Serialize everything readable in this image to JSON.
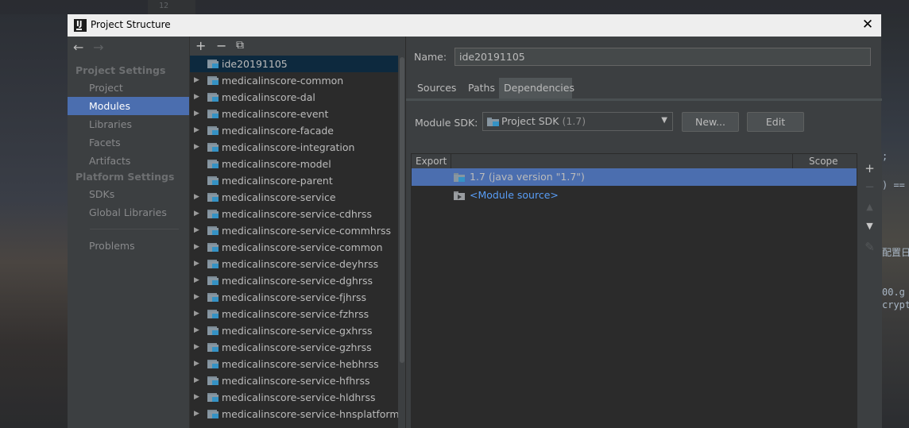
{
  "background": {
    "line_number": "12",
    "code_lines": [
      ";",
      ") ==",
      "配置日",
      "00.g",
      "crypt"
    ]
  },
  "dialog": {
    "title": "Project Structure",
    "close_glyph": "✕"
  },
  "left_nav": {
    "back_glyph": "←",
    "forward_glyph": "→",
    "project_settings_header": "Project Settings",
    "project_settings": [
      "Project",
      "Modules",
      "Libraries",
      "Facets",
      "Artifacts"
    ],
    "platform_settings_header": "Platform Settings",
    "platform_settings": [
      "SDKs",
      "Global Libraries"
    ],
    "problems": "Problems",
    "selected": "Modules"
  },
  "tree": {
    "toolbar": {
      "add": "+",
      "remove": "−",
      "copy": "⧉"
    },
    "items": [
      {
        "label": "ide20191105",
        "expandable": false,
        "selected": true
      },
      {
        "label": "medicalinscore-common",
        "expandable": true
      },
      {
        "label": "medicalinscore-dal",
        "expandable": true
      },
      {
        "label": "medicalinscore-event",
        "expandable": true
      },
      {
        "label": "medicalinscore-facade",
        "expandable": true
      },
      {
        "label": "medicalinscore-integration",
        "expandable": true
      },
      {
        "label": "medicalinscore-model",
        "expandable": false
      },
      {
        "label": "medicalinscore-parent",
        "expandable": false
      },
      {
        "label": "medicalinscore-service",
        "expandable": true
      },
      {
        "label": "medicalinscore-service-cdhrss",
        "expandable": true
      },
      {
        "label": "medicalinscore-service-commhrss",
        "expandable": true
      },
      {
        "label": "medicalinscore-service-common",
        "expandable": true
      },
      {
        "label": "medicalinscore-service-deyhrss",
        "expandable": true
      },
      {
        "label": "medicalinscore-service-dghrss",
        "expandable": true
      },
      {
        "label": "medicalinscore-service-fjhrss",
        "expandable": true
      },
      {
        "label": "medicalinscore-service-fzhrss",
        "expandable": true
      },
      {
        "label": "medicalinscore-service-gxhrss",
        "expandable": true
      },
      {
        "label": "medicalinscore-service-gzhrss",
        "expandable": true
      },
      {
        "label": "medicalinscore-service-hebhrss",
        "expandable": true
      },
      {
        "label": "medicalinscore-service-hfhrss",
        "expandable": true
      },
      {
        "label": "medicalinscore-service-hldhrss",
        "expandable": true
      },
      {
        "label": "medicalinscore-service-hnsplatformhrss",
        "expandable": true
      }
    ]
  },
  "module": {
    "name_label": "Name:",
    "name_value": "ide20191105",
    "tabs": [
      "Sources",
      "Paths",
      "Dependencies"
    ],
    "active_tab": "Dependencies",
    "sdk_label": "Module SDK:",
    "sdk_value": "Project SDK",
    "sdk_version": "(1.7)",
    "new_button": "New...",
    "edit_button": "Edit"
  },
  "dependencies": {
    "columns": [
      "Export",
      "Scope"
    ],
    "rows": [
      {
        "label": "1.7 (java version \"1.7\")",
        "selected": true,
        "color": "#bbbbbb"
      },
      {
        "label": "<Module source>",
        "selected": false,
        "color": "#589df6"
      }
    ],
    "side_buttons": [
      {
        "glyph": "+",
        "name": "add-dependency-button",
        "enabled": true
      },
      {
        "glyph": "−",
        "name": "remove-dependency-button",
        "enabled": false
      },
      {
        "glyph": "▲",
        "name": "move-up-button",
        "enabled": false
      },
      {
        "glyph": "▼",
        "name": "move-down-button",
        "enabled": true
      },
      {
        "glyph": "✎",
        "name": "edit-dependency-button",
        "enabled": false
      }
    ]
  },
  "colors": {
    "selection": "#4b6eaf",
    "tree_selection": "#0d293e",
    "panel": "#3c3f41",
    "list_bg": "#2b2b2b",
    "text": "#bbbbbb",
    "link": "#589df6"
  },
  "icons": [
    "close-icon",
    "back-arrow-icon",
    "forward-arrow-icon",
    "module-folder-icon",
    "sdk-folder-icon",
    "chevron-down-icon"
  ]
}
